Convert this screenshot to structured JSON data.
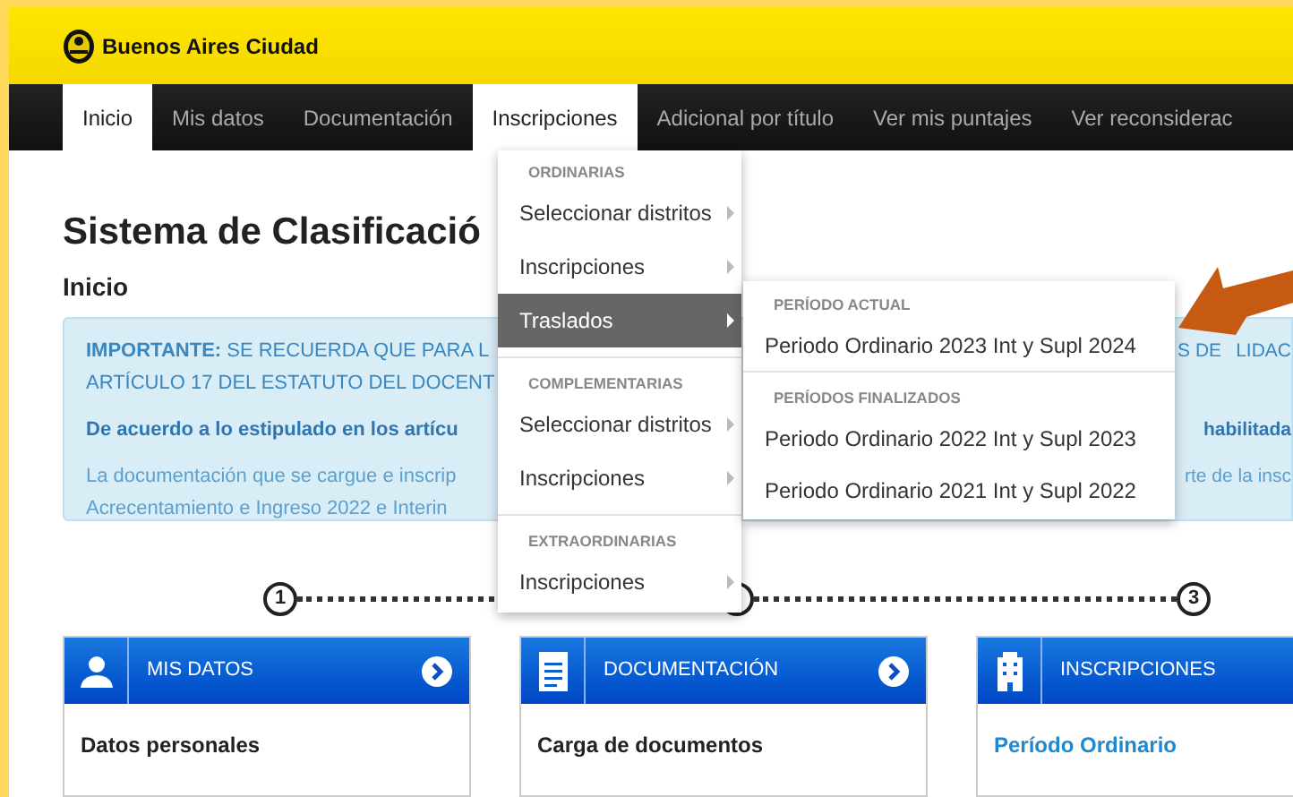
{
  "header": {
    "brand": "Buenos Aires Ciudad"
  },
  "nav": {
    "tabs": [
      {
        "label": "Inicio",
        "selected": true
      },
      {
        "label": "Mis datos",
        "selected": false
      },
      {
        "label": "Documentación",
        "selected": false
      },
      {
        "label": "Inscripciones",
        "selected": true
      },
      {
        "label": "Adicional por título",
        "selected": false
      },
      {
        "label": "Ver mis puntajes",
        "selected": false
      },
      {
        "label": "Ver reconsiderac",
        "selected": false
      }
    ]
  },
  "page": {
    "title": "Sistema de Clasificació",
    "subtitle": "Inicio"
  },
  "notice": {
    "lines": [
      {
        "kind": "plain",
        "left": "**IMPORTANTE:** SE RECUERDA QUE PARA L",
        "right": "S DE",
        "right_2": "LIDAC"
      },
      {
        "kind": "plain",
        "left": "ARTÍCULO 17 DEL ESTATUTO DEL DOCENT"
      },
      {
        "kind": "bold",
        "left": "De acuerdo a lo estipulado en los artícu",
        "right": "habilitada"
      },
      {
        "kind": "light",
        "left": "La documentación que se cargue e inscrip",
        "right": "rte de la insc"
      },
      {
        "kind": "light",
        "left": "Acrecentamiento e Ingreso 2022 e Interin"
      }
    ]
  },
  "steps": [
    "1",
    "3"
  ],
  "cards": [
    {
      "title": "MIS DATOS",
      "kind": "person",
      "arrow": true,
      "heading": "Datos personales"
    },
    {
      "title": "DOCUMENTACIÓN",
      "kind": "document",
      "arrow": true,
      "heading": "Carga de documentos"
    },
    {
      "title": "INSCRIPCIONES",
      "kind": "building",
      "link": "Período Ordinario"
    }
  ],
  "menu": {
    "sections": [
      {
        "heading": "ORDINARIAS",
        "items": [
          {
            "label": "Seleccionar distritos",
            "highlighted": false
          },
          {
            "label": "Inscripciones",
            "highlighted": false
          },
          {
            "label": "Traslados",
            "highlighted": true
          }
        ]
      },
      {
        "heading": "COMPLEMENTARIAS",
        "items": [
          {
            "label": "Seleccionar distritos",
            "highlighted": false
          },
          {
            "label": "Inscripciones",
            "highlighted": false
          }
        ]
      },
      {
        "heading": "EXTRAORDINARIAS",
        "items": [
          {
            "label": "Inscripciones",
            "highlighted": false
          }
        ]
      }
    ]
  },
  "submenu": {
    "sections": [
      {
        "heading": "PERÍODO ACTUAL",
        "items": [
          {
            "label": "Periodo Ordinario 2023 Int y Supl 2024"
          }
        ]
      },
      {
        "heading": "PERÍODOS FINALIZADOS",
        "items": [
          {
            "label": "Periodo Ordinario 2022 Int y Supl 2023"
          },
          {
            "label": "Periodo Ordinario 2021 Int y Supl 2022"
          }
        ]
      }
    ]
  }
}
